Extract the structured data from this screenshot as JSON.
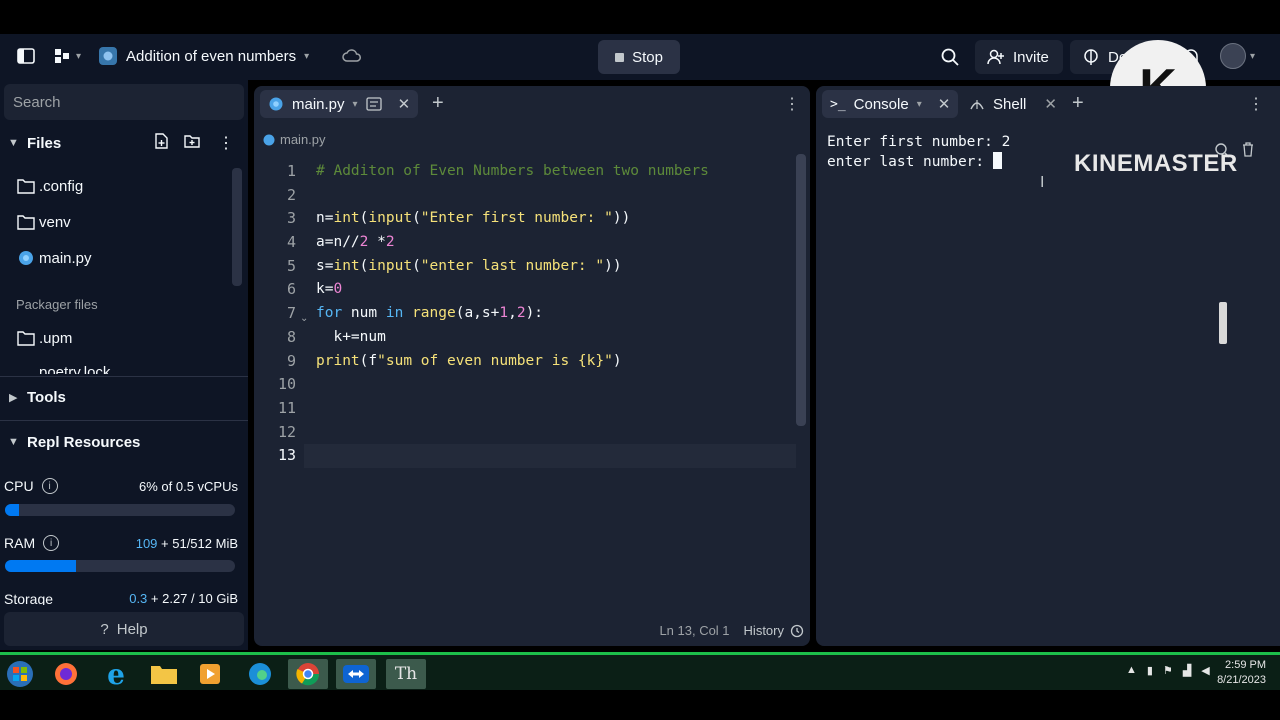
{
  "topbar": {
    "repl_name": "Addition of even numbers",
    "stop_label": "Stop",
    "invite_label": "Invite",
    "deploy_label": "Deploy"
  },
  "sidebar": {
    "search_placeholder": "Search",
    "files_header": "Files",
    "files": [
      {
        "name": ".config",
        "icon": "folder-icon"
      },
      {
        "name": "venv",
        "icon": "folder-icon"
      },
      {
        "name": "main.py",
        "icon": "python-icon"
      }
    ],
    "packager_label": "Packager files",
    "packager_files": [
      {
        "name": ".upm",
        "icon": "folder-icon"
      },
      {
        "name": "poetry.lock",
        "icon": "file-icon"
      }
    ],
    "tools_header": "Tools",
    "resources_header": "Repl Resources",
    "cpu": {
      "label": "CPU",
      "value": "6% of 0.5 vCPUs",
      "fill": 0.06
    },
    "ram": {
      "label": "RAM",
      "used": "109",
      "rest": " + 51/512 MiB",
      "fill": 0.31
    },
    "storage": {
      "label": "Storage",
      "used": "0.3",
      "rest": " + 2.27 / 10 GiB"
    },
    "help_label": "Help"
  },
  "editor": {
    "tab_label": "main.py",
    "breadcrumb": "main.py",
    "line_numbers": [
      "1",
      "2",
      "3",
      "4",
      "5",
      "6",
      "7",
      "8",
      "9",
      "10",
      "11",
      "12",
      "13"
    ],
    "code": {
      "l1": "# Additon of Even Numbers between two numbers",
      "l3_a": "n=",
      "l3_fn1": "int",
      "l3_b": "(",
      "l3_fn2": "input",
      "l3_c": "(",
      "l3_str": "\"Enter first number: \"",
      "l3_d": "))",
      "l4_a": "a=n//",
      "l4_n1": "2",
      "l4_b": " *",
      "l4_n2": "2",
      "l5_a": "s=",
      "l5_fn1": "int",
      "l5_b": "(",
      "l5_fn2": "input",
      "l5_c": "(",
      "l5_str": "\"enter last number: \"",
      "l5_d": "))",
      "l6_a": "k=",
      "l6_n": "0",
      "l7_kw1": "for",
      "l7_a": " num ",
      "l7_kw2": "in",
      "l7_b": " ",
      "l7_fn": "range",
      "l7_c": "(a,s+",
      "l7_n1": "1",
      "l7_d": ",",
      "l7_n2": "2",
      "l7_e": "):",
      "l8": "  k+=num",
      "l9_fn": "print",
      "l9_a": "(f",
      "l9_str": "\"sum of even number is {k}\"",
      "l9_b": ")"
    },
    "status_position": "Ln 13, Col 1",
    "history_label": "History"
  },
  "console": {
    "tab_console": "Console",
    "tab_shell": "Shell",
    "output_line1": "Enter first number: 2",
    "output_line2": "enter last number: "
  },
  "watermark": {
    "logo_letter": "K",
    "text": "KINEMASTER"
  },
  "taskbar": {
    "time": "2:59 PM",
    "date": "8/21/2023"
  },
  "colors": {
    "bg": "#0e1525",
    "panel": "#1c2333",
    "accent": "#0079f2",
    "taskbar_accent": "#1dbf4a"
  }
}
